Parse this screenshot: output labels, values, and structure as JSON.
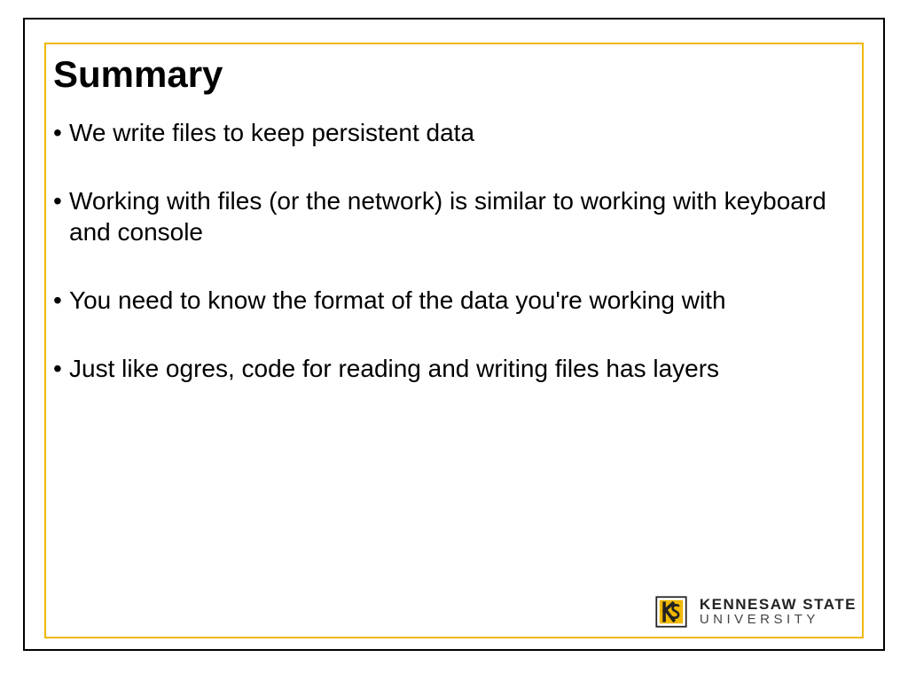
{
  "slide": {
    "title": "Summary",
    "bullets": [
      "We write files to keep persistent data",
      "Working with files (or the network) is similar to working with keyboard and console",
      "You need to know the format of the data you're working with",
      "Just like ogres, code for reading and writing files has layers"
    ]
  },
  "logo": {
    "line1": "KENNESAW STATE",
    "line2": "UNIVERSITY",
    "gold": "#f0b800",
    "dark": "#222222"
  }
}
